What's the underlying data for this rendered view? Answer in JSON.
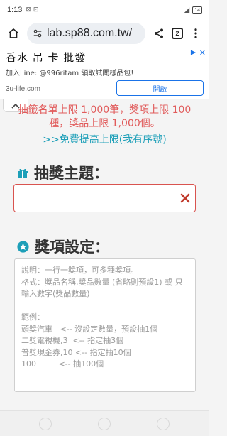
{
  "status": {
    "time": "1:13",
    "notification_icons": "⊠ ⊡",
    "signal": "◢",
    "battery": "14"
  },
  "browser": {
    "url": "lab.sp88.com.tw/",
    "tab_count": "2"
  },
  "ad": {
    "title": "香水 吊 卡 批發",
    "subtitle": "加入Line: @996ritam 領取試聞樣品包!",
    "domain": "3u-life.com",
    "open_button": "開啟"
  },
  "notice": {
    "limit_line1": "抽籤名單上限 1,000筆，獎項上限 100",
    "limit_line2": "種，獎品上限 1,000個。",
    "free_upgrade": ">>免費提高上限(我有序號)"
  },
  "form": {
    "theme_title": "抽獎主題：",
    "theme_value": "",
    "prize_title": "獎項設定：",
    "prize_placeholder_lines": [
      "說明：一行一獎項，可多種獎項。",
      "格式：獎品名稱,獎品數量 (省略則預設1) 或 只",
      "輸入數字(獎品數量)",
      "",
      "範例：",
      "頭獎汽車   <-- 沒設定數量，預設抽1個",
      "二獎電視機,3  <-- 指定抽3個",
      "普獎現金券,10 <-- 指定抽10個",
      "100         <-- 抽100個"
    ]
  },
  "colors": {
    "accent_red": "#e15b5b",
    "accent_teal": "#1d9fb8",
    "input_error_border": "#d9534f"
  }
}
